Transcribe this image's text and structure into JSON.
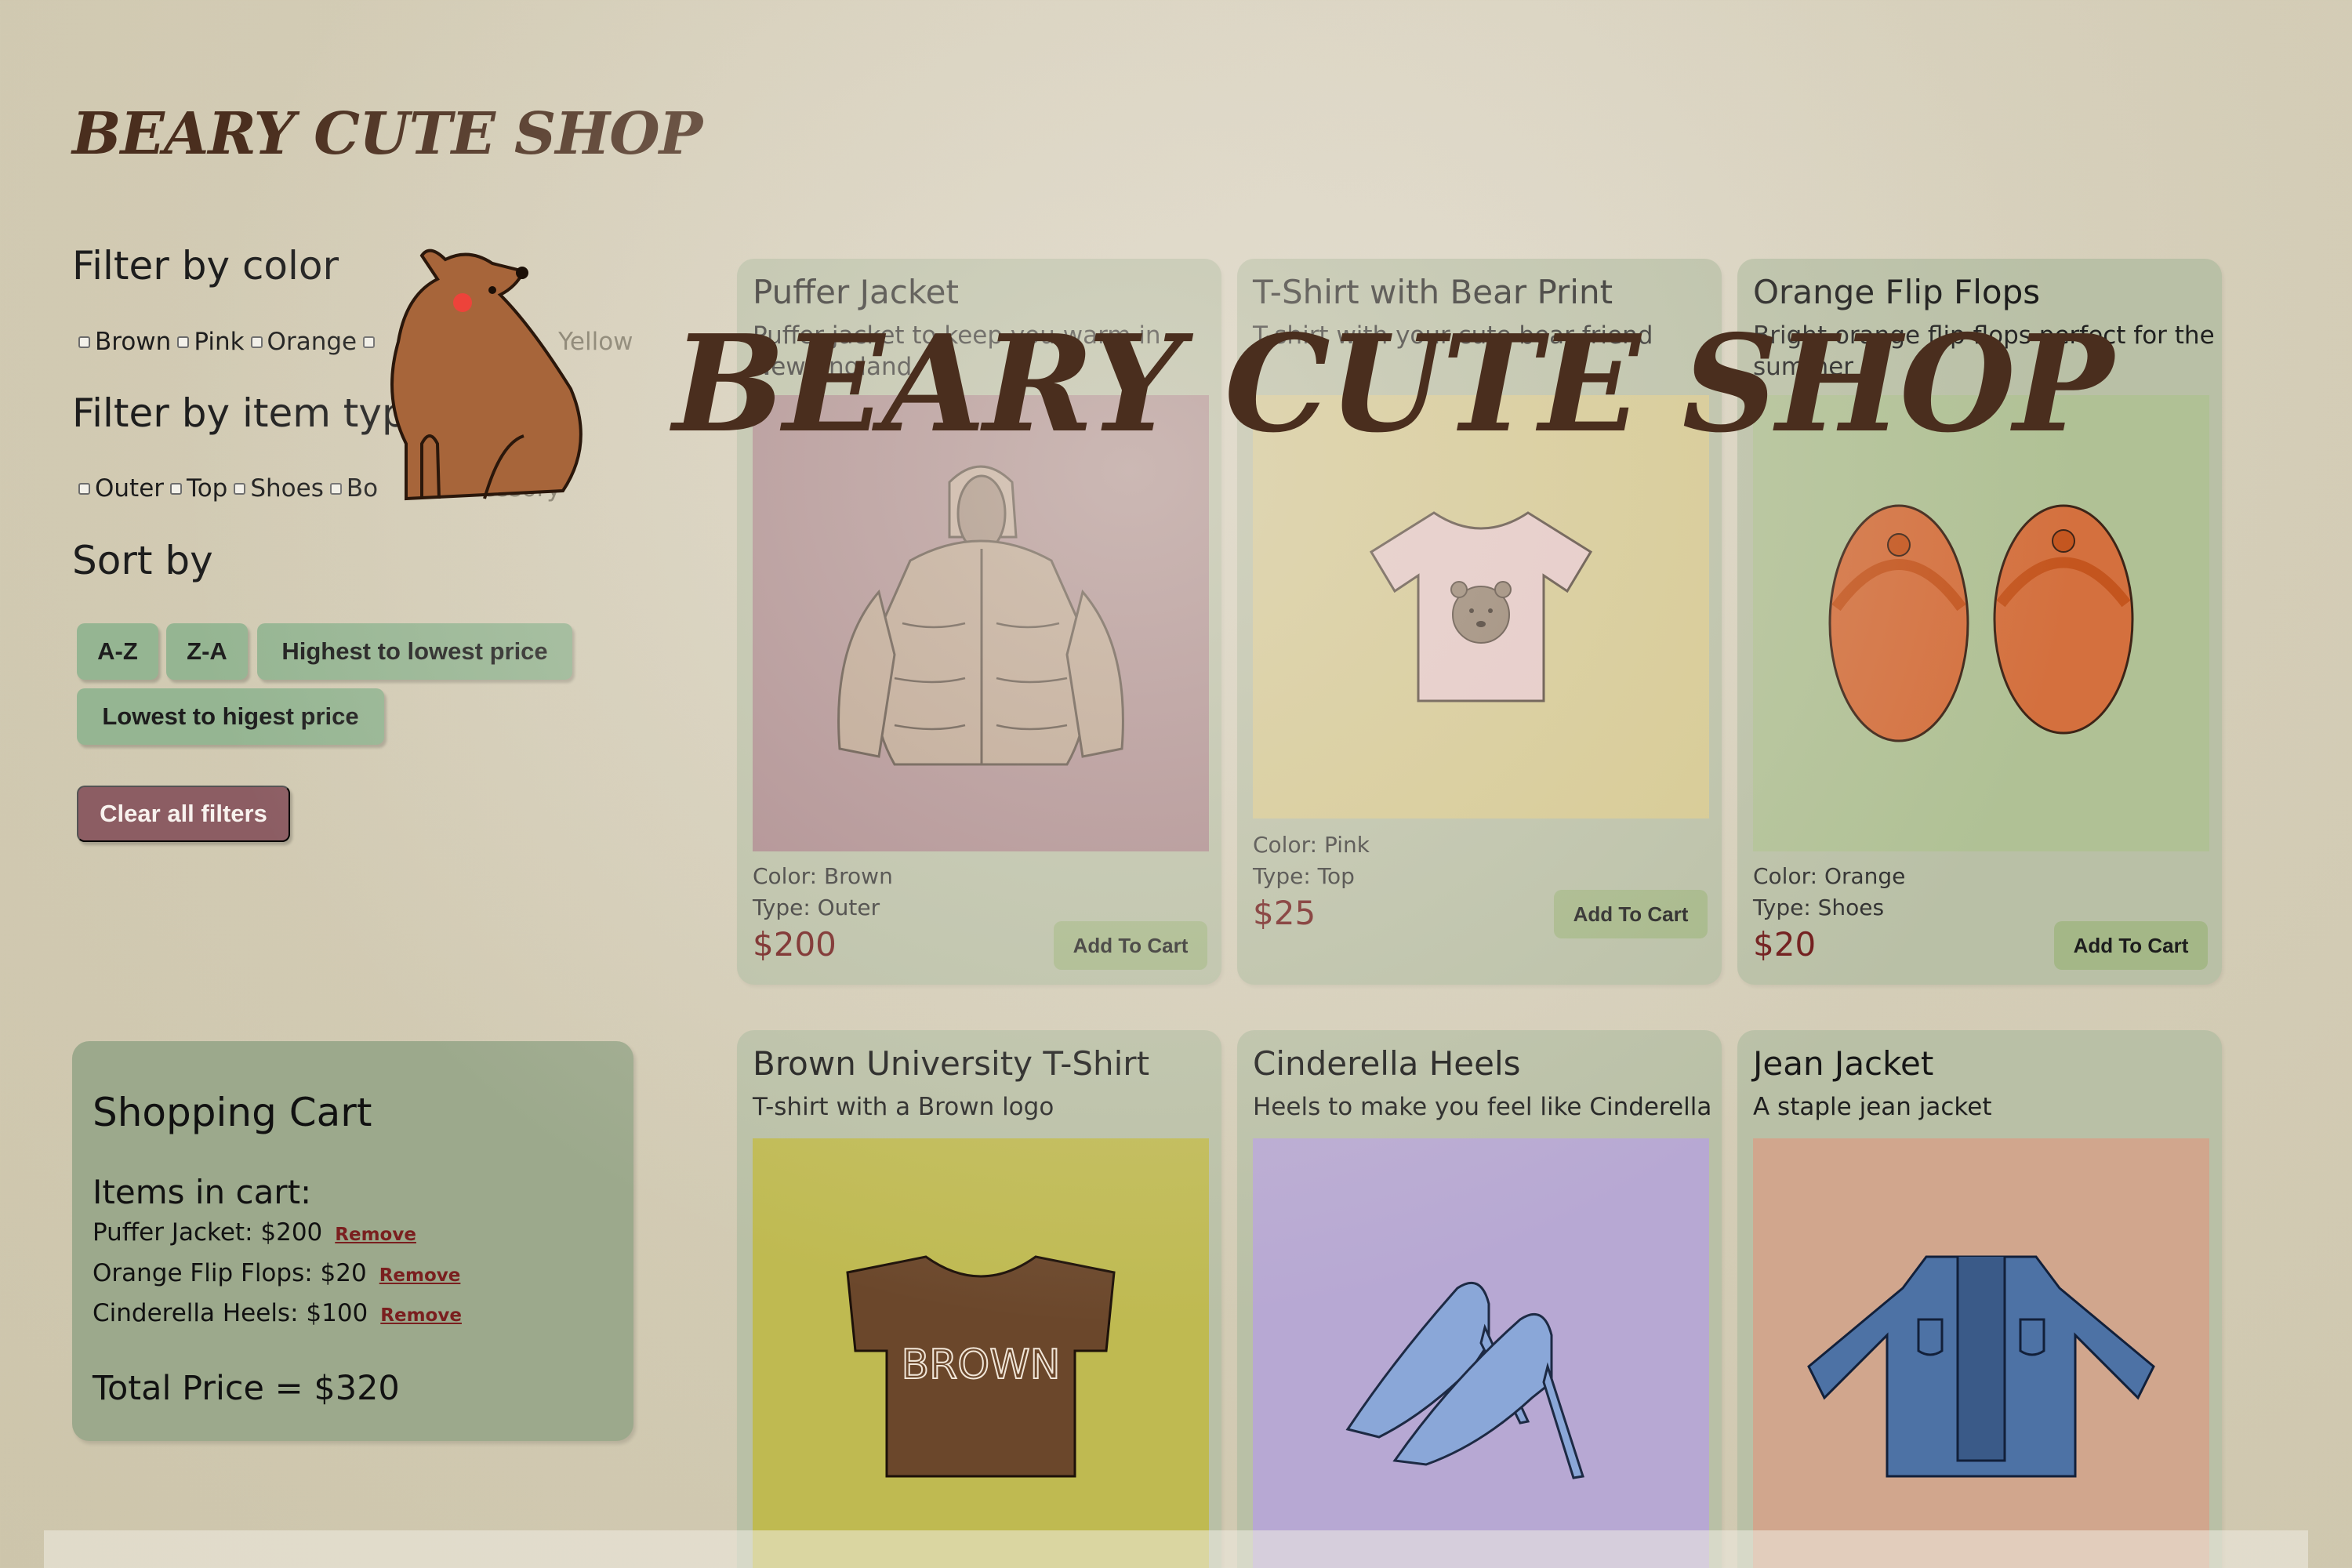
{
  "shop": {
    "title": "BEARY CUTE SHOP",
    "overlay_title": "BEARY CUTE SHOP"
  },
  "filters": {
    "color_heading": "Filter by color",
    "colors": [
      "Brown",
      "Pink",
      "Orange",
      "Yellow"
    ],
    "type_heading": "Filter by item typ",
    "types": [
      "Outer",
      "Top",
      "Shoes",
      "Bo",
      "ccessory"
    ],
    "sort_heading": "Sort by",
    "sort_buttons": [
      "A-Z",
      "Z-A",
      "Highest to lowest price",
      "Lowest to higest price"
    ],
    "clear_label": "Clear all filters"
  },
  "cart": {
    "title": "Shopping Cart",
    "subtitle": "Items in cart:",
    "items": [
      {
        "label": "Puffer Jacket: $200",
        "remove": "Remove"
      },
      {
        "label": "Orange Flip Flops: $20",
        "remove": "Remove"
      },
      {
        "label": "Cinderella Heels: $100",
        "remove": "Remove"
      }
    ],
    "total": "Total Price = $320"
  },
  "products": [
    {
      "name": "Puffer Jacket",
      "desc": "Puffer jacket to keep you warm in New England",
      "color": "Color: Brown",
      "type": "Type: Outer",
      "price": "$200",
      "button": "Add To Cart",
      "bg": "#a9858a",
      "icon": "puffer-jacket-icon"
    },
    {
      "name": "T-Shirt with Bear Print",
      "desc": "T-shirt with your cute bear friend",
      "color": "Color: Pink",
      "type": "Type: Top",
      "price": "$25",
      "button": "Add To Cart",
      "bg": "#d6c98e",
      "icon": "bear-tshirt-icon"
    },
    {
      "name": "Orange Flip Flops",
      "desc": "Bright orange flip flops perfect for the summer",
      "color": "Color: Orange",
      "type": "Type: Shoes",
      "price": "$20",
      "button": "Add To Cart",
      "bg": "#b0c195",
      "icon": "flip-flops-icon"
    },
    {
      "name": "Brown University T-Shirt",
      "desc": "T-shirt with a Brown logo",
      "bg": "#bfba51",
      "icon": "brown-tshirt-icon",
      "shirt_text": "BROWN"
    },
    {
      "name": "Cinderella Heels",
      "desc": "Heels to make you feel like Cinderella",
      "bg": "#b7a8d3",
      "icon": "heels-icon"
    },
    {
      "name": "Jean Jacket",
      "desc": "A staple jean jacket",
      "bg": "#d1a68d",
      "icon": "jean-jacket-icon"
    }
  ]
}
